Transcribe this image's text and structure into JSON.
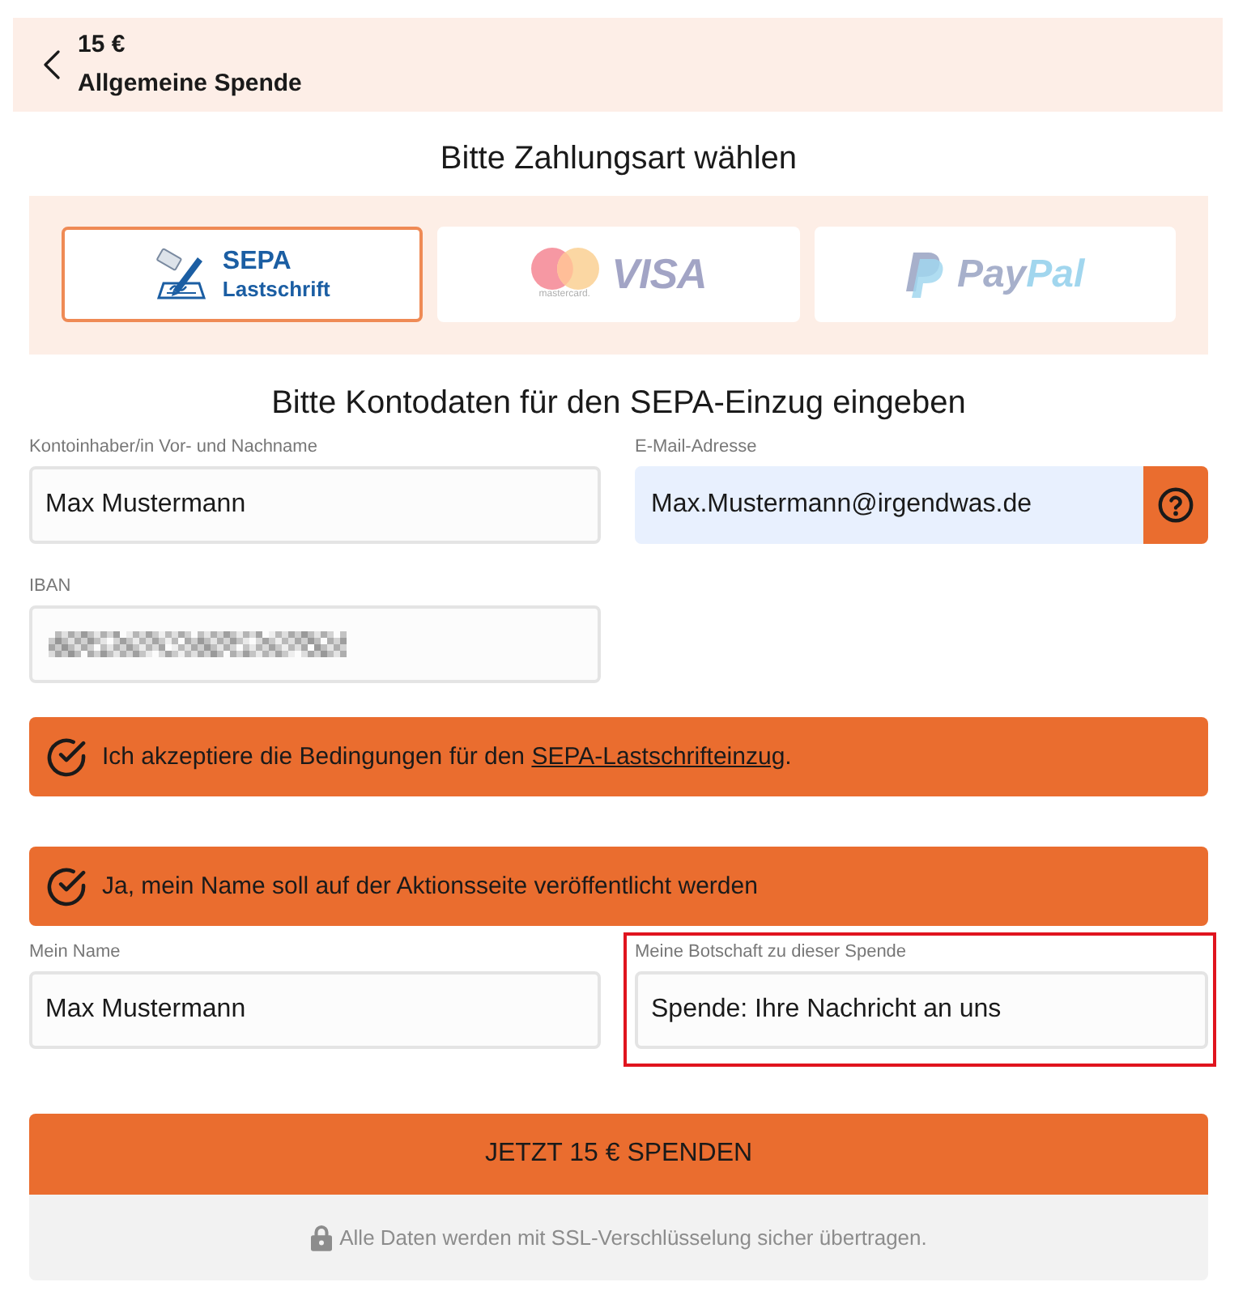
{
  "header": {
    "amount": "15 €",
    "title": "Allgemeine Spende"
  },
  "payment": {
    "heading": "Bitte Zahlungsart wählen",
    "methods": [
      {
        "kind": "sepa",
        "selected": true,
        "line_1": "SEPA",
        "line_2": "Lastschrift"
      },
      {
        "kind": "card",
        "selected": false,
        "caption": "mastercard.",
        "brand": "VISA"
      },
      {
        "kind": "paypal",
        "selected": false,
        "name_parts": [
          "Pay",
          "Pal"
        ]
      }
    ]
  },
  "account": {
    "heading": "Bitte Kontodaten für den SEPA-Einzug eingeben",
    "fields": [
      {
        "kind": "plain",
        "label": "Kontoinhaber/in Vor- und Nachname",
        "value": "Max Mustermann",
        "autofilled": false
      },
      {
        "kind": "help",
        "label": "E-Mail-Adresse",
        "value": "Max.Mustermann@irgendwas.de",
        "autofilled": true
      },
      {
        "kind": "masked",
        "label": "IBAN",
        "autofilled": false
      }
    ]
  },
  "consents": [
    {
      "checked": true,
      "text": "Ich akzeptiere die Bedingungen für den ",
      "link": "SEPA-Lastschrifteinzug",
      "suffix": "."
    },
    {
      "checked": true,
      "text": "Ja, mein Name soll auf der Aktionsseite veröffentlicht werden"
    }
  ],
  "public": {
    "fields": [
      {
        "label": "Mein Name",
        "value": "Max Mustermann",
        "highlighted": false
      },
      {
        "label": "Meine Botschaft zu dieser Spende",
        "value": "Spende: Ihre Nachricht an uns",
        "highlighted": true
      }
    ]
  },
  "submit": {
    "label": "JETZT 15 € SPENDEN"
  },
  "security_note": "Alle Daten werden mit SSL-Verschlüsselung sicher übertragen."
}
